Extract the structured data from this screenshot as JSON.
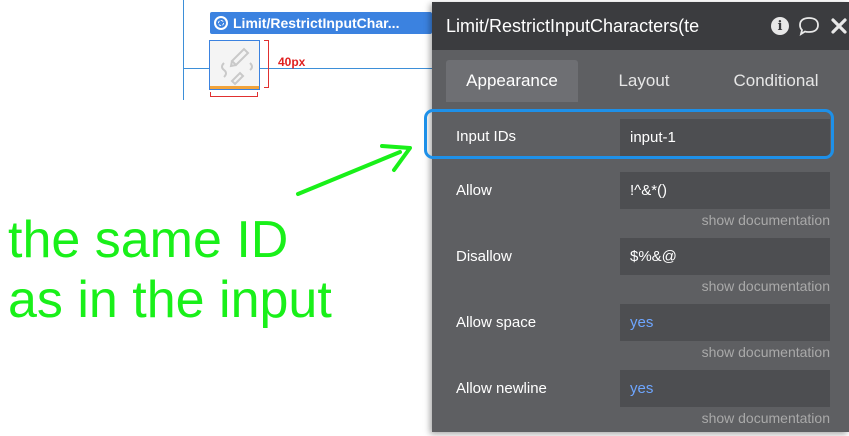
{
  "canvas": {
    "element_label": "Limit/RestrictInputChar...",
    "dimension_label": "40px"
  },
  "annotation": {
    "line1": "the same ID",
    "line2": "as in the input",
    "color": "#19f019"
  },
  "panel": {
    "title": "Limit/RestrictInputCharacters(te",
    "icons": [
      "info-icon",
      "comment-icon",
      "close-icon"
    ],
    "tabs": [
      {
        "label": "Appearance",
        "active": true
      },
      {
        "label": "Layout",
        "active": false
      },
      {
        "label": "Conditional",
        "active": false
      }
    ],
    "fields": [
      {
        "label": "Input IDs",
        "value": "input-1",
        "doc": ""
      },
      {
        "label": "Allow",
        "value": "!^&*()",
        "doc": "show documentation"
      },
      {
        "label": "Disallow",
        "value": "$%&@",
        "doc": "show documentation"
      },
      {
        "label": "Allow space",
        "value": "yes",
        "doc": "show documentation"
      },
      {
        "label": "Allow newline",
        "value": "yes",
        "doc": "show documentation"
      }
    ]
  },
  "colors": {
    "accent_blue": "#1e90e8",
    "panel_bg": "#5e5f62",
    "header_bg": "#3b3c3f",
    "link_blue": "#6ea6ff"
  }
}
